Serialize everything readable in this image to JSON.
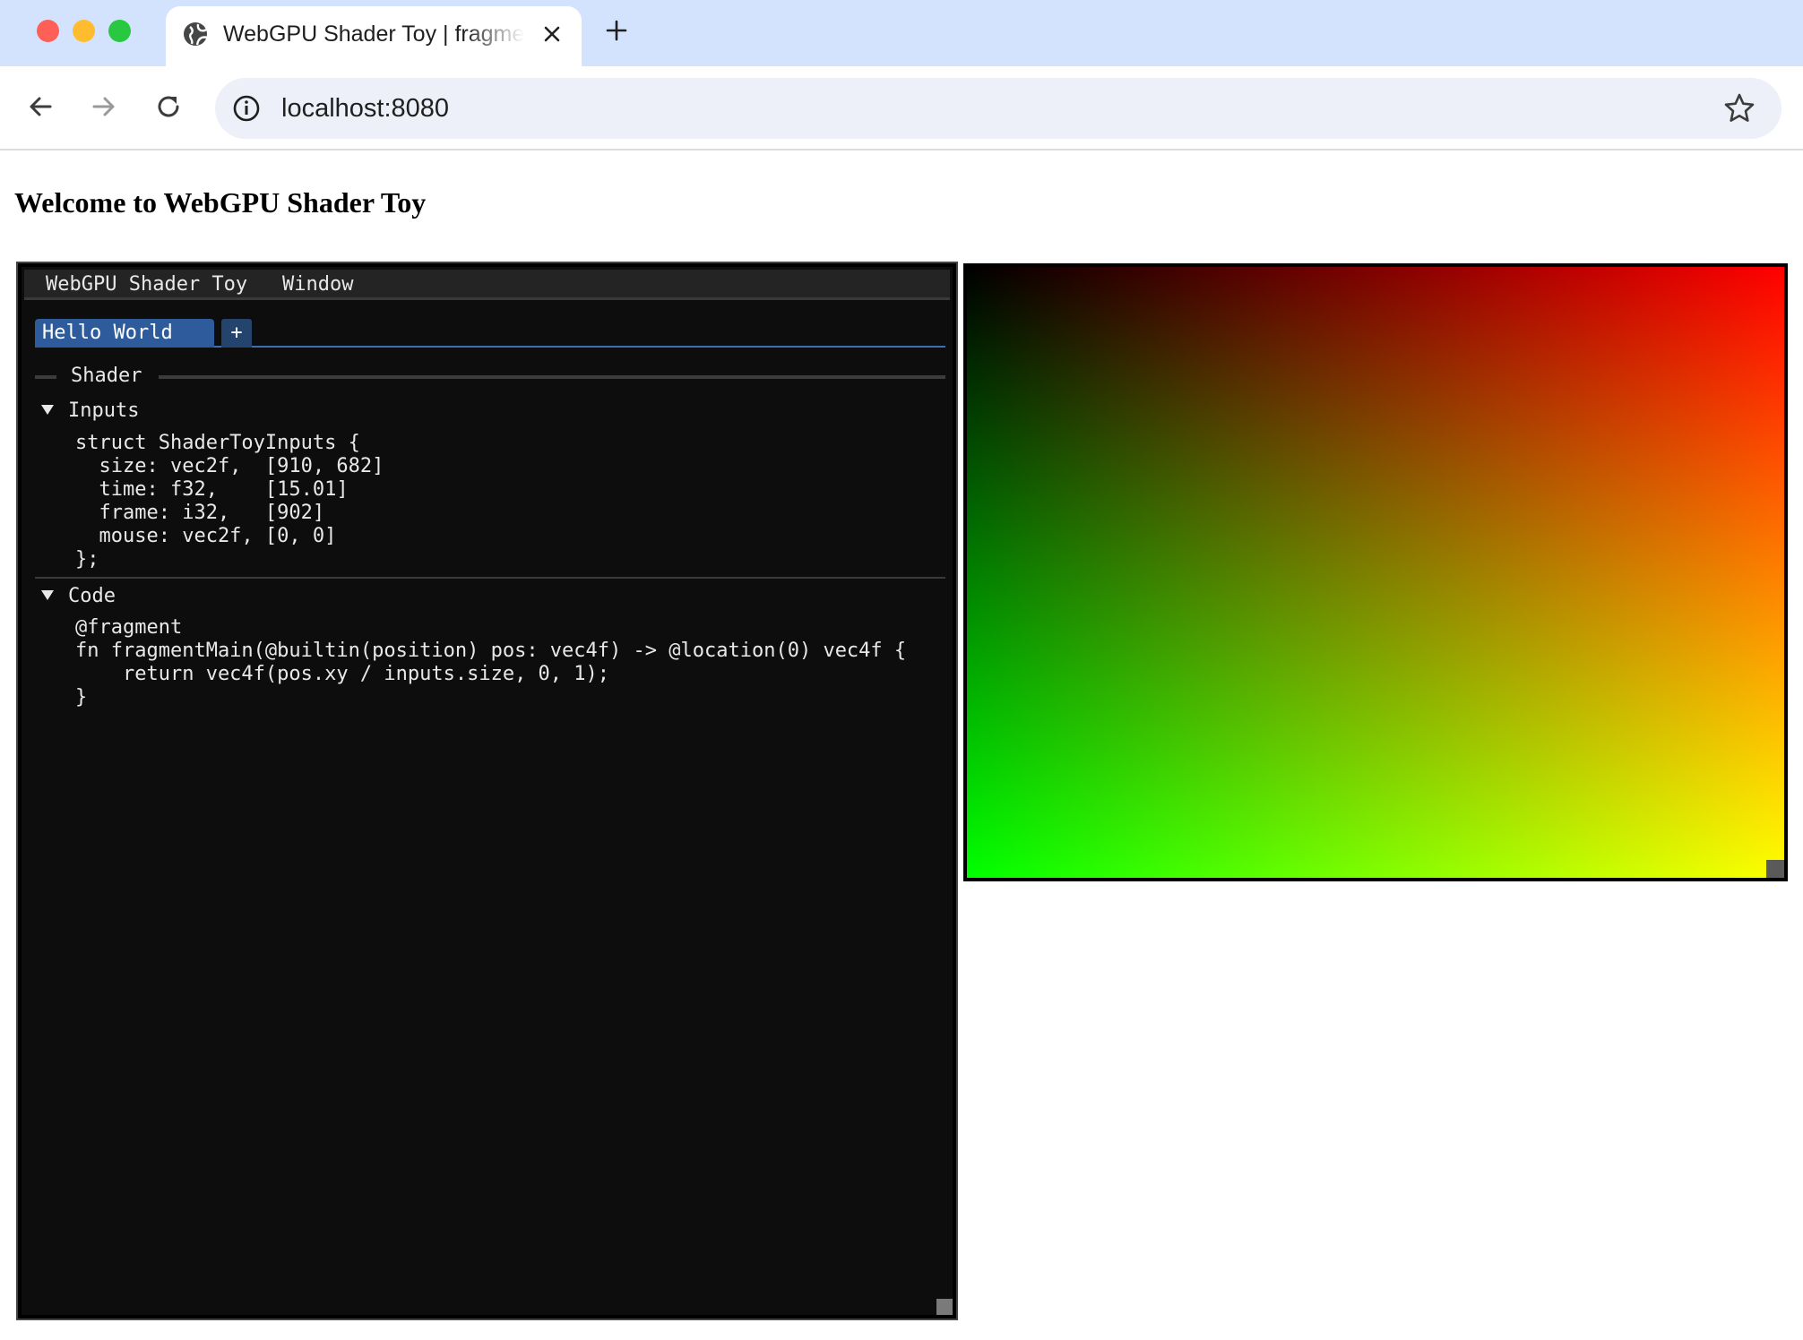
{
  "browser": {
    "tab_title": "WebGPU Shader Toy | fragment",
    "url": "localhost:8080"
  },
  "page": {
    "heading": "Welcome to WebGPU Shader Toy"
  },
  "imgui": {
    "menu": [
      "WebGPU Shader Toy",
      "Window"
    ],
    "tabs": [
      {
        "label": "Hello World",
        "selected": true
      }
    ],
    "add_tab_label": "+",
    "section_label": "Shader",
    "inputs_header": "Inputs",
    "inputs_code": "struct ShaderToyInputs {\n  size: vec2f,  [910, 682]\n  time: f32,    [15.01]\n  frame: i32,   [902]\n  mouse: vec2f, [0, 0]\n};",
    "code_header": "Code",
    "shader_code": "@fragment\nfn fragmentMain(@builtin(position) pos: vec4f) -> @location(0) vec4f {\n    return vec4f(pos.xy / inputs.size, 0, 1);\n}"
  },
  "colors": {
    "tabstrip": "#d3e3fd",
    "imgui_tab_active": "#2d5b9b",
    "imgui_bg": "#0d0d0d"
  }
}
